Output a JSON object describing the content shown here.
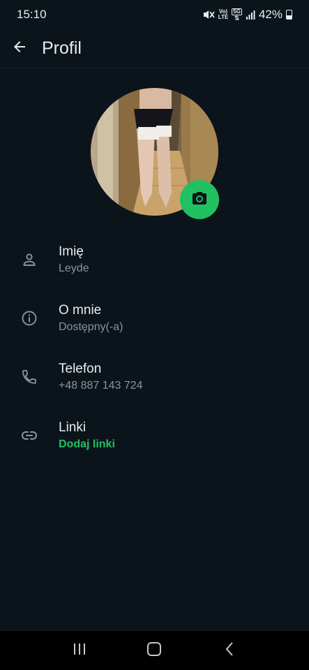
{
  "status_bar": {
    "time": "15:10",
    "volte_top": "Vo)",
    "volte_bottom": "LTE",
    "net_top": "5G",
    "battery": "42%",
    "icons": [
      "mute-icon",
      "volte-icon",
      "5g-icon",
      "signal-icon",
      "battery-icon"
    ]
  },
  "header": {
    "title": "Profil",
    "back_icon": "arrow-left-icon"
  },
  "profile_photo": {
    "camera_icon": "camera-icon"
  },
  "rows": [
    {
      "icon": "person-icon",
      "label": "Imię",
      "value": "Leyde"
    },
    {
      "icon": "info-icon",
      "label": "O mnie",
      "value": "Dostępny(-a)"
    },
    {
      "icon": "phone-icon",
      "label": "Telefon",
      "value": "+48 887 143 724"
    },
    {
      "icon": "link-icon",
      "label": "Linki",
      "value": "Dodaj linki"
    }
  ],
  "colors": {
    "background": "#0b141a",
    "accent": "#21c063",
    "text_primary": "#e9edef",
    "text_secondary": "#8696a0"
  },
  "nav_bar": {
    "icons": [
      "recents-icon",
      "home-icon",
      "back-icon"
    ]
  }
}
